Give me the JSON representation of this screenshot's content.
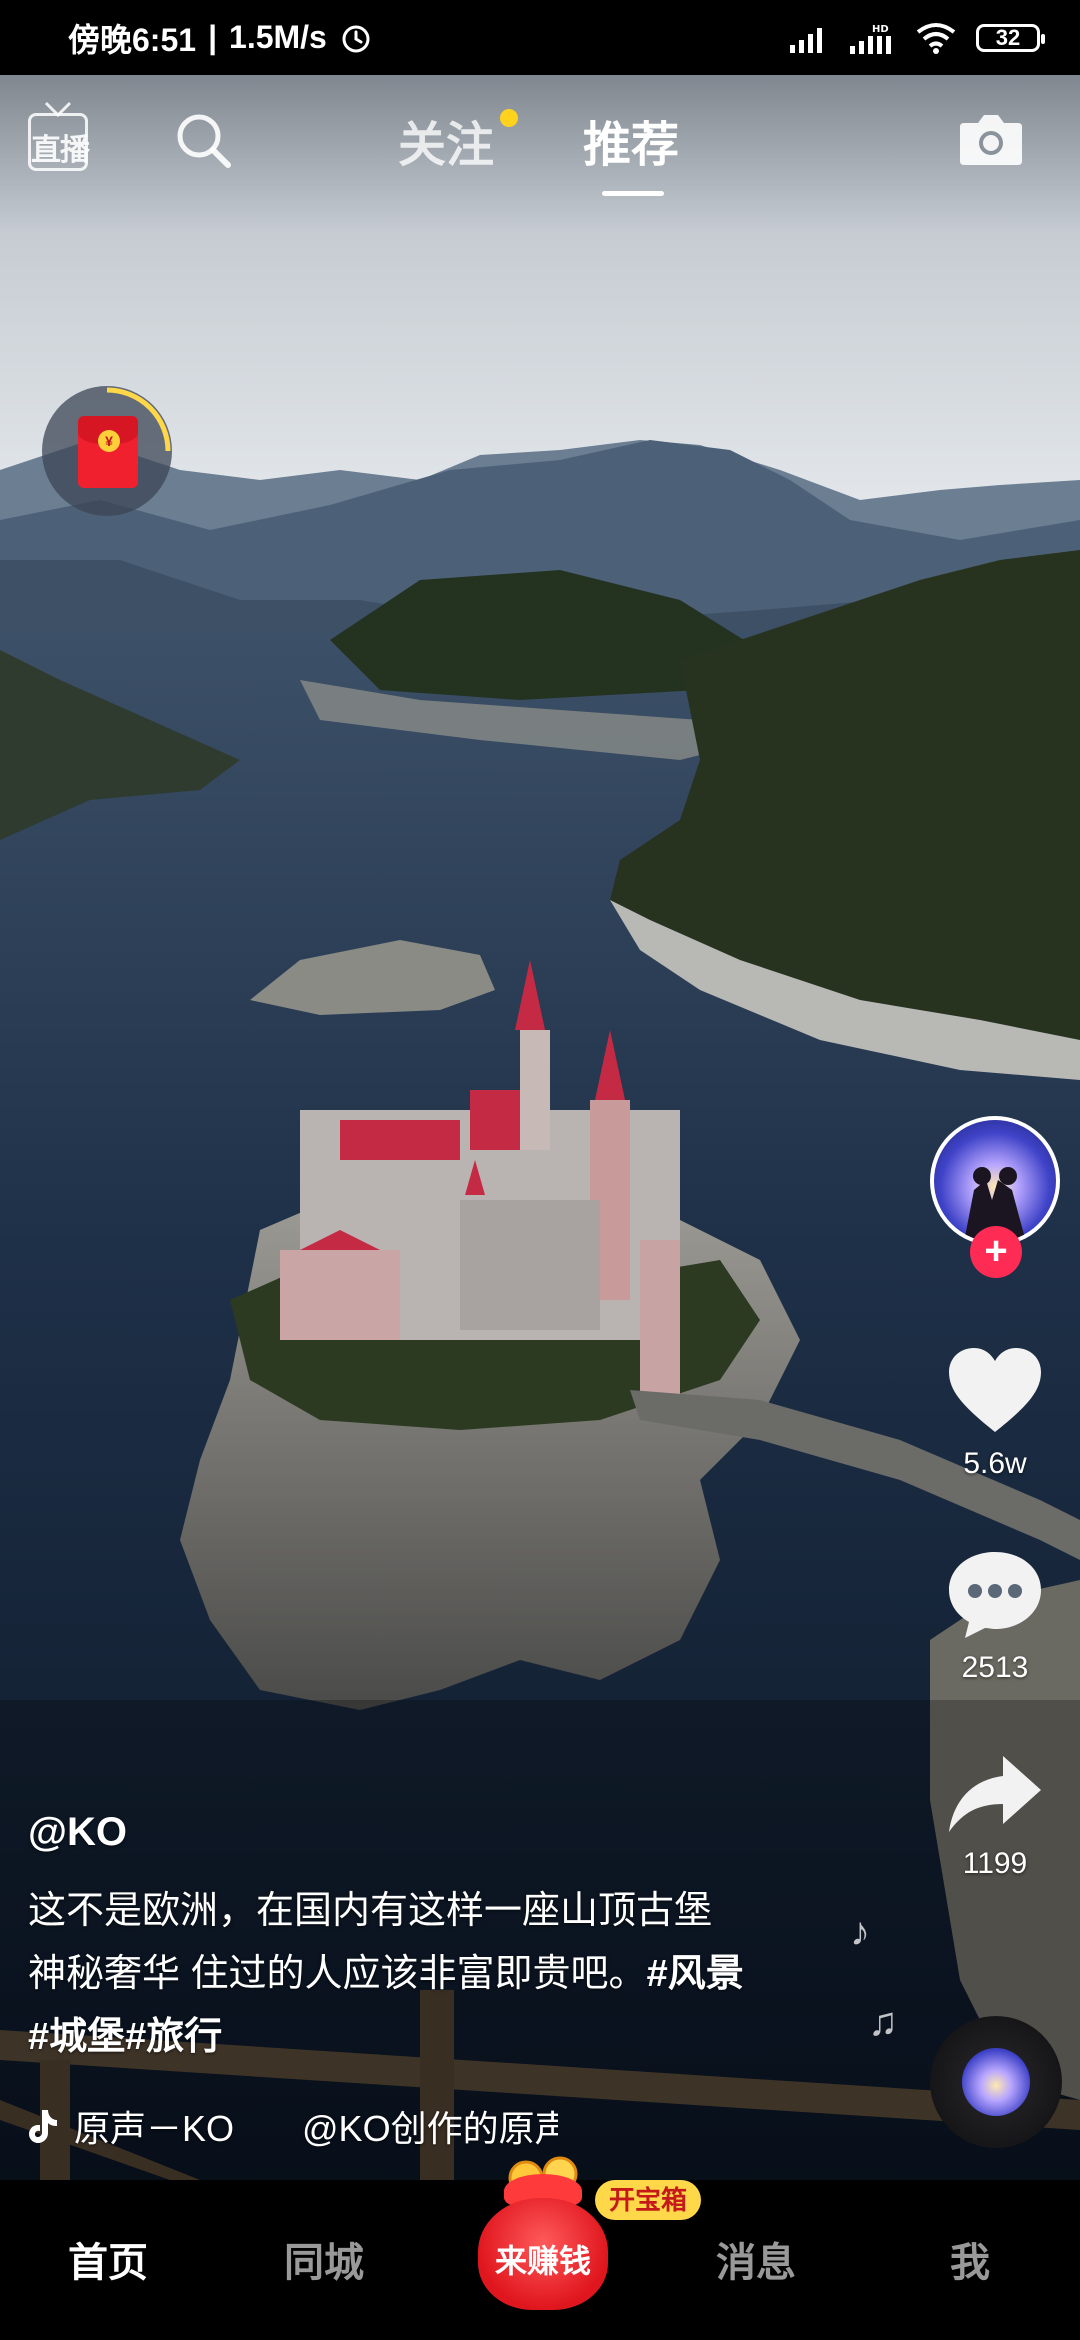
{
  "status_bar": {
    "time": "傍晚6:51",
    "speed": "1.5M/s",
    "battery": "32"
  },
  "top_nav": {
    "live_label": "直播",
    "follow_tab": "关注",
    "recommend_tab": "推荐"
  },
  "rail": {
    "likes": "5.6w",
    "comments": "2513",
    "shares": "1199"
  },
  "post": {
    "author": "@KO",
    "caption_line1": "这不是欧洲，在国内有这样一座山顶古堡",
    "caption_line2": "神秘奢华 住过的人应该非富即贵吧。",
    "tags": [
      "#风景",
      "#城堡",
      "#旅行"
    ],
    "music_title": "原声－KO",
    "music_creator": "@KO创作的原声"
  },
  "bottom_nav": {
    "home": "首页",
    "city": "同城",
    "earn": "来赚钱",
    "chest": "开宝箱",
    "messages": "消息",
    "me": "我"
  },
  "colors": {
    "accent_red": "#fe2c55",
    "follow_dot": "#ffd21e",
    "chest_yellow": "#ffd84a"
  }
}
